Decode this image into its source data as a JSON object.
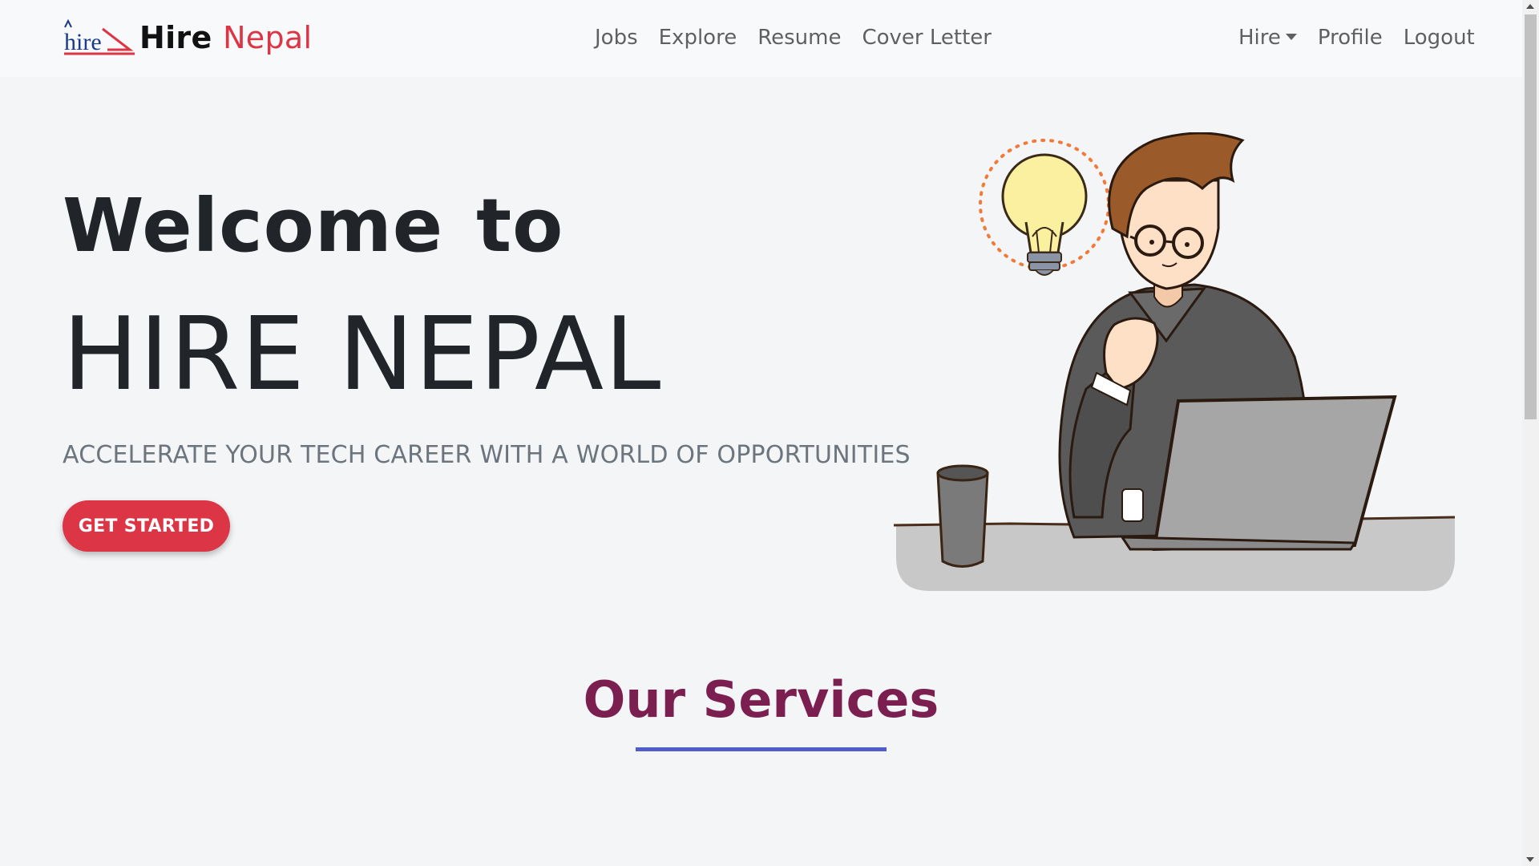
{
  "brand": {
    "word1": "Hire",
    "word2": "Nepal",
    "logo_text": "hire"
  },
  "nav": {
    "center": [
      "Jobs",
      "Explore",
      "Resume",
      "Cover Letter"
    ],
    "hire_dropdown": "Hire",
    "profile": "Profile",
    "logout": "Logout"
  },
  "hero": {
    "title_line1": "Welcome to",
    "title_line2": "HIRE NEPAL",
    "subtitle": "ACCELERATE YOUR TECH CAREER WITH A WORLD OF OPPORTUNITIES",
    "cta_label": "GET STARTED"
  },
  "services": {
    "title": "Our Services"
  },
  "colors": {
    "accent_red": "#dc3545",
    "services_title": "#7a1f50",
    "underline": "#4e5dc9",
    "logo_blue": "#1a3a8c"
  }
}
